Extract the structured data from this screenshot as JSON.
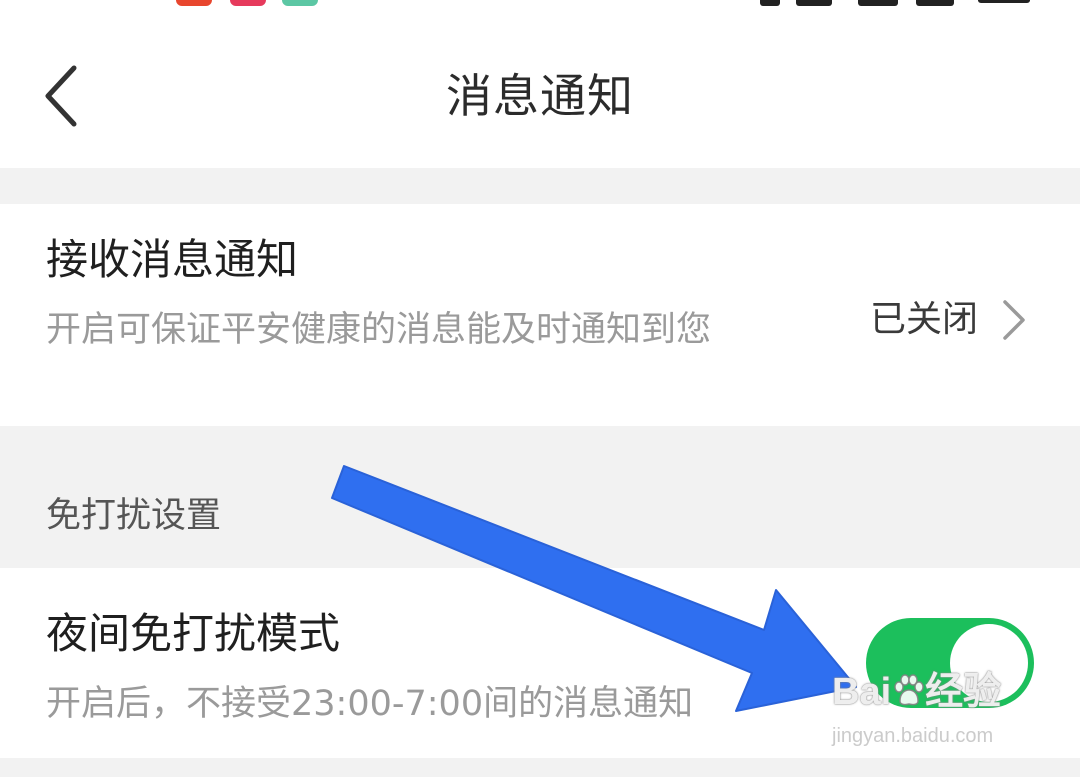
{
  "header": {
    "title": "消息通知"
  },
  "notify_row": {
    "title": "接收消息通知",
    "description": "开启可保证平安健康的消息能及时通知到您",
    "value": "已关闭"
  },
  "section": {
    "label": "免打扰设置"
  },
  "night_row": {
    "title": "夜间免打扰模式",
    "description": "开启后，不接受23:00-7:00间的消息通知",
    "toggle_on": true
  },
  "watermark": {
    "logo_prefix": "Bai",
    "logo_suffix": "经验",
    "url": "jingyan.baidu.com"
  },
  "colors": {
    "toggle_on": "#1cbf5c",
    "arrow": "#2f6ff0",
    "background": "#f2f2f2",
    "card": "#ffffff"
  },
  "icons": {
    "back": "chevron-left-icon",
    "row_arrow": "chevron-right-icon",
    "overlay": "arrow-annotation-icon",
    "watermark": "baidu-paw-icon"
  }
}
